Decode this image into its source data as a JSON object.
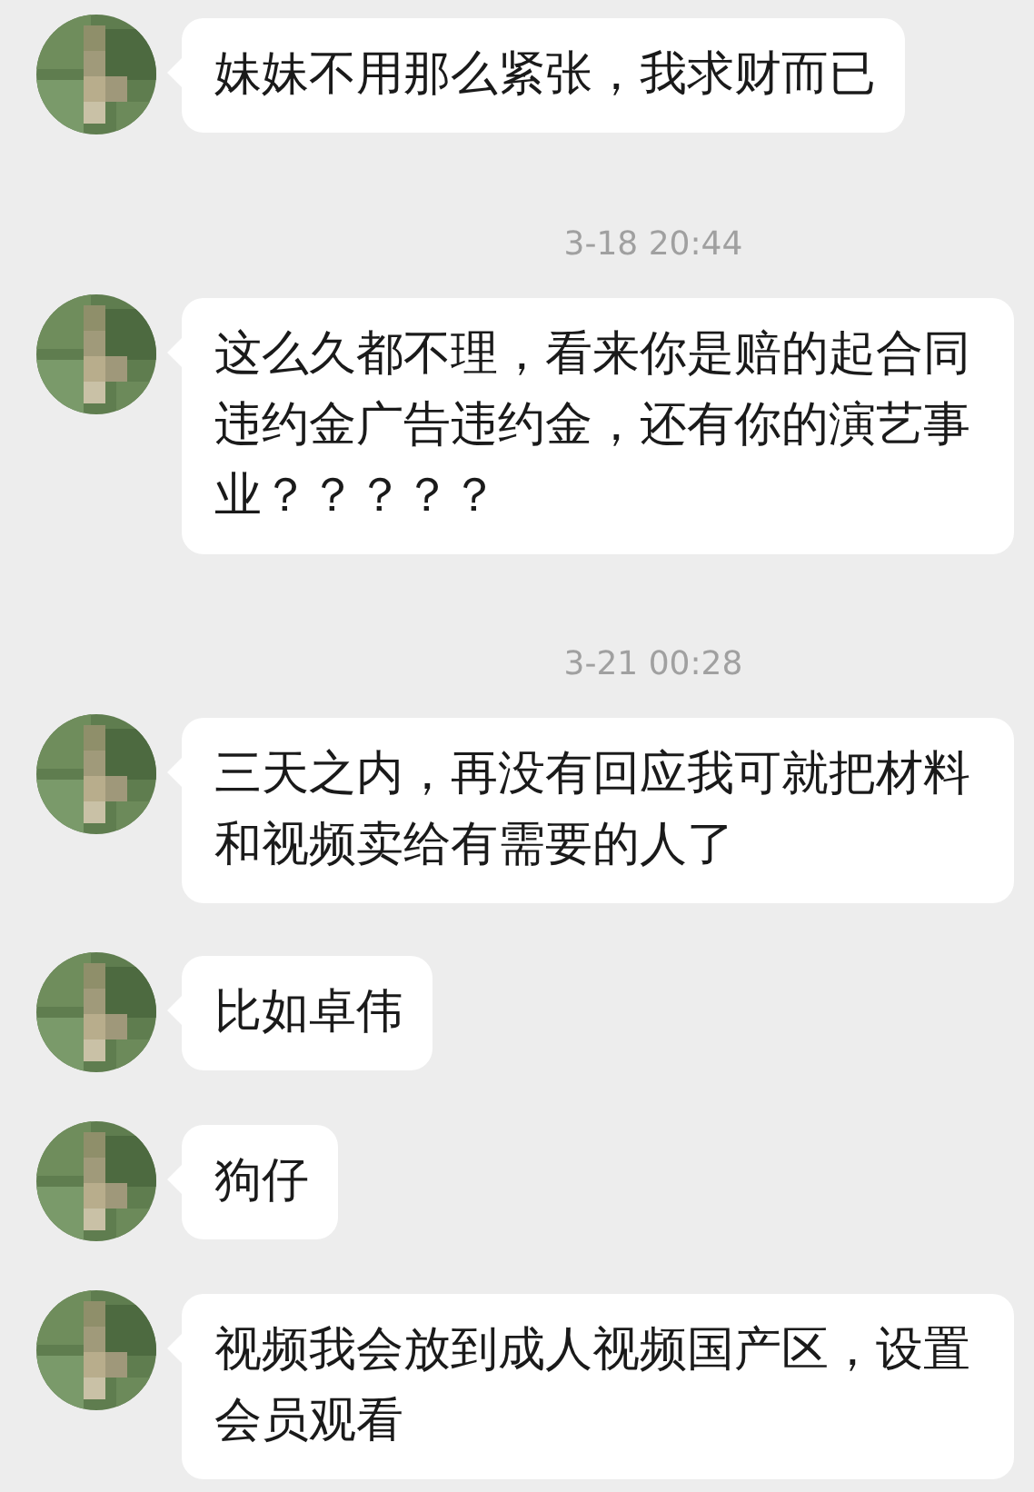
{
  "chat": [
    {
      "kind": "message",
      "text": "妹妹不用那么紧张，我求财而已"
    },
    {
      "kind": "time",
      "text": "3-18 20:44"
    },
    {
      "kind": "message",
      "text": "这么久都不理，看来你是赔的起合同违约金广告违约金，还有你的演艺事业？？？？？"
    },
    {
      "kind": "time",
      "text": "3-21 00:28"
    },
    {
      "kind": "message",
      "text": "三天之内，再没有回应我可就把材料和视频卖给有需要的人了"
    },
    {
      "kind": "message",
      "text": "比如卓伟"
    },
    {
      "kind": "message",
      "text": "狗仔"
    },
    {
      "kind": "message",
      "text": "视频我会放到成人视频国产区，设置会员观看"
    }
  ]
}
